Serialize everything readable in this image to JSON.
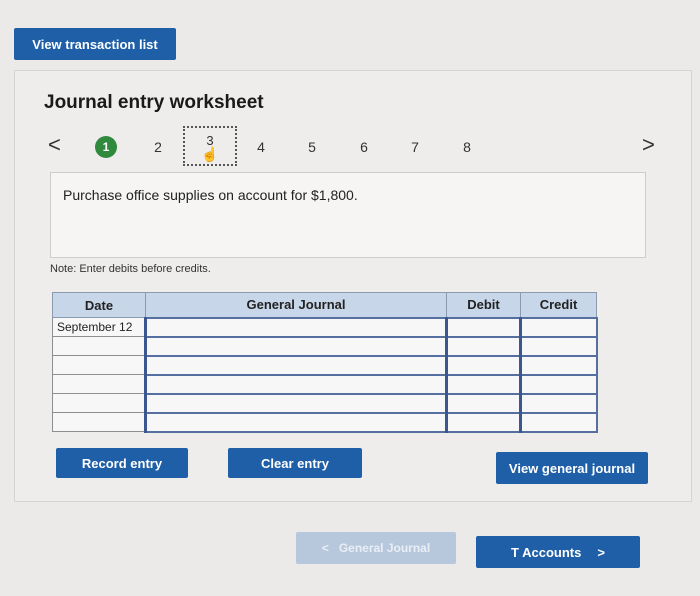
{
  "header": {
    "view_transactions_label": "View transaction list"
  },
  "worksheet": {
    "title": "Journal entry worksheet",
    "prev_arrow": "<",
    "next_arrow": ">",
    "steps": [
      "1",
      "2",
      "3",
      "4",
      "5",
      "6",
      "7",
      "8"
    ],
    "completed_step": "1",
    "current_step": "3",
    "description": "Purchase office supplies on account for $1,800.",
    "note": "Note: Enter debits before credits."
  },
  "table": {
    "columns": [
      "Date",
      "General Journal",
      "Debit",
      "Credit"
    ],
    "rows": [
      {
        "date": "September 12",
        "account": "",
        "debit": "",
        "credit": ""
      },
      {
        "date": "",
        "account": "",
        "debit": "",
        "credit": ""
      },
      {
        "date": "",
        "account": "",
        "debit": "",
        "credit": ""
      },
      {
        "date": "",
        "account": "",
        "debit": "",
        "credit": ""
      },
      {
        "date": "",
        "account": "",
        "debit": "",
        "credit": ""
      },
      {
        "date": "",
        "account": "",
        "debit": "",
        "credit": ""
      }
    ]
  },
  "actions": {
    "record_entry": "Record entry",
    "clear_entry": "Clear entry",
    "view_general_journal": "View general journal"
  },
  "footer": {
    "prev_label": "General Journal",
    "prev_chevron": "<",
    "next_label": "T Accounts",
    "next_chevron": ">"
  },
  "colors": {
    "primary_button": "#1f5fa8",
    "completed_step": "#2f8a3e",
    "table_header": "#c7d6e8"
  }
}
